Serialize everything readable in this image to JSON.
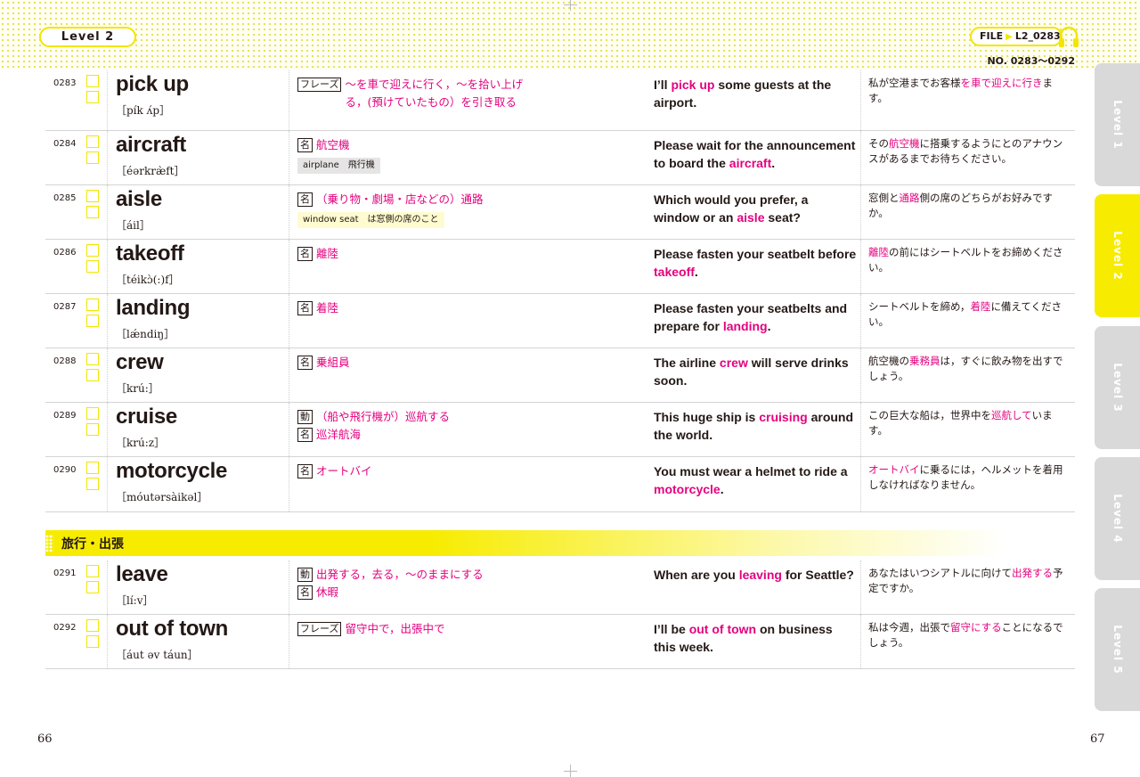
{
  "header": {
    "level": "Level 2",
    "file_prefix": "FILE",
    "file_id": "L2_0283",
    "range": "NO. 0283～0292"
  },
  "side_tabs": [
    {
      "label": "Level 1",
      "active": false
    },
    {
      "label": "Level 2",
      "active": true
    },
    {
      "label": "Level 3",
      "active": false
    },
    {
      "label": "Level 4",
      "active": false
    },
    {
      "label": "Level 5",
      "active": false
    }
  ],
  "entries": [
    {
      "num": "0283",
      "word": "pick up",
      "pron": "［pík ʌ́p］",
      "meanings": [
        {
          "pos": "フレーズ",
          "text": "～を車で迎えに行く，～を拾い上げる，(預けていたもの）を引き取る"
        }
      ],
      "example": [
        "I’ll ",
        "pick up",
        " some guests at the airport."
      ],
      "translation": [
        "私が空港までお客様",
        "を車で迎えに行き",
        "ます。"
      ]
    },
    {
      "num": "0284",
      "word": "aircraft",
      "pron": "［éərkræ̀ft］",
      "meanings": [
        {
          "pos": "名",
          "text": "航空機"
        }
      ],
      "note": "airplane　飛行機",
      "example": [
        "Please wait for the announcement to board the ",
        "aircraft",
        "."
      ],
      "translation": [
        "その",
        "航空機",
        "に搭乗するようにとのアナウンスがあるまでお待ちください。"
      ]
    },
    {
      "num": "0285",
      "word": "aisle",
      "pron": "［áil］",
      "meanings": [
        {
          "pos": "名",
          "text": "（乗り物・劇場・店などの）通路"
        }
      ],
      "note": "window seat　は窓側の席のこと",
      "example": [
        "Which would you prefer, a window or an ",
        "aisle",
        " seat?"
      ],
      "translation": [
        "窓側と",
        "通路",
        "側の席のどちらがお好みですか。"
      ]
    },
    {
      "num": "0286",
      "word": "takeoff",
      "pron": "［téikɔ̀(:)f］",
      "meanings": [
        {
          "pos": "名",
          "text": "離陸"
        }
      ],
      "example": [
        "Please fasten your seatbelt before ",
        "takeoff",
        "."
      ],
      "translation": [
        "",
        "離陸",
        "の前にはシートベルトをお締めください。"
      ]
    },
    {
      "num": "0287",
      "word": "landing",
      "pron": "［lǽndiŋ］",
      "meanings": [
        {
          "pos": "名",
          "text": "着陸"
        }
      ],
      "example": [
        "Please fasten your seatbelts and prepare for ",
        "landing",
        "."
      ],
      "translation": [
        "シートベルトを締め，",
        "着陸",
        "に備えてください。"
      ]
    },
    {
      "num": "0288",
      "word": "crew",
      "pron": "［krú:］",
      "meanings": [
        {
          "pos": "名",
          "text": "乗組員"
        }
      ],
      "example": [
        "The airline ",
        "crew",
        " will serve drinks soon."
      ],
      "translation": [
        "航空機の",
        "乗務員",
        "は，すぐに飲み物を出すでしょう。"
      ]
    },
    {
      "num": "0289",
      "word": "cruise",
      "pron": "［krú:z］",
      "meanings": [
        {
          "pos": "動",
          "text": "（船や飛行機が）巡航する"
        },
        {
          "pos": "名",
          "text": "巡洋航海"
        }
      ],
      "example": [
        "This huge ship is ",
        "cruising",
        " around the world."
      ],
      "translation": [
        "この巨大な船は，世界中を",
        "巡航して",
        "います。"
      ]
    },
    {
      "num": "0290",
      "word": "motorcycle",
      "pron": "［móutərsàikəl］",
      "meanings": [
        {
          "pos": "名",
          "text": "オートバイ"
        }
      ],
      "example": [
        "You must wear a helmet to ride a ",
        "motorcycle",
        "."
      ],
      "translation": [
        "",
        "オートバイ",
        "に乗るには，ヘルメットを着用しなければなりません。"
      ]
    },
    {
      "num": "0291",
      "word": "leave",
      "pron": "［lí:v］",
      "meanings": [
        {
          "pos": "動",
          "text": "出発する，去る，～のままにする"
        },
        {
          "pos": "名",
          "text": "休暇"
        }
      ],
      "example": [
        "When are you ",
        "leaving",
        " for Seattle?"
      ],
      "translation": [
        "あなたはいつシアトルに向けて",
        "出発する",
        "予定ですか。"
      ]
    },
    {
      "num": "0292",
      "word": "out of town",
      "pron": "［áut əv táun］",
      "meanings": [
        {
          "pos": "フレーズ",
          "text": "留守中で，出張中で"
        }
      ],
      "example": [
        "I’ll be ",
        "out of town",
        " on business this week."
      ],
      "translation": [
        "私は今週，出張で",
        "留守にする",
        "ことになるでしょう。"
      ]
    }
  ],
  "section": {
    "title": "旅行・出張"
  },
  "footer": {
    "page_left": "66",
    "page_right": "67"
  },
  "colors": {
    "accent_yellow": "#f7ec00",
    "highlight_pink": "#e4007f"
  }
}
